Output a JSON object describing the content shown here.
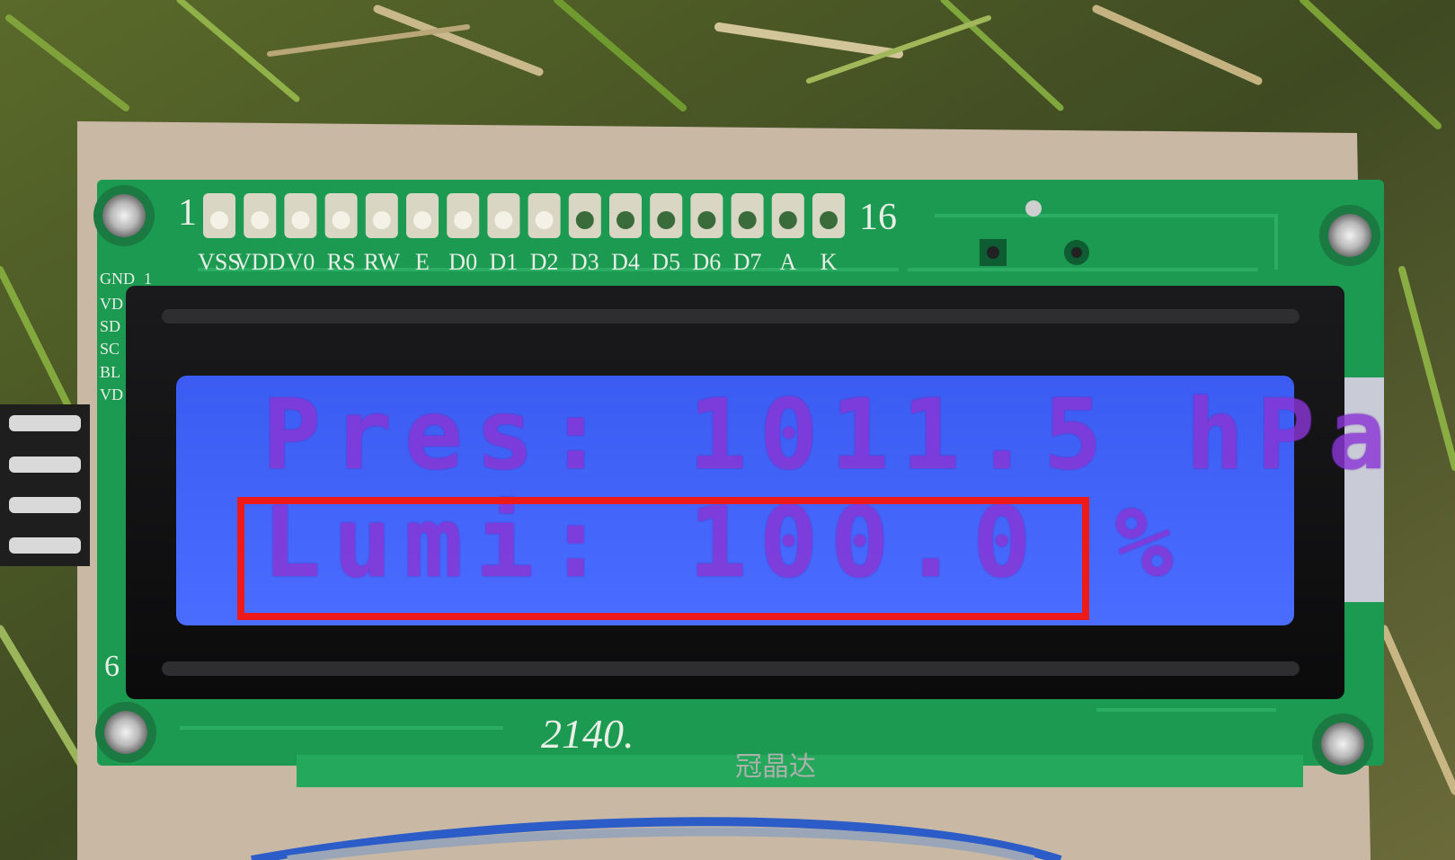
{
  "lcd": {
    "line1": "Pres: 1011.5 hPa",
    "line2": "Lumi: 100.0 %"
  },
  "pcb": {
    "pin_first": "1",
    "pin_last": "16",
    "pin_labels": [
      "VSS",
      "VDD",
      "V0",
      "RS",
      "RW",
      "E",
      "D0",
      "D1",
      "D2",
      "D3",
      "D4",
      "D5",
      "D6",
      "D7",
      "A",
      "K"
    ],
    "side_labels": [
      "GND",
      "1",
      "VD",
      "SD",
      "SC",
      "BL",
      "VD"
    ],
    "side_pin_number": "6",
    "silk_code": "2140.",
    "brand_mark": "冠晶达"
  },
  "colors": {
    "pcb_green": "#1c9a52",
    "lcd_backlight": "#3f62f5",
    "lcd_text": "#8a35d6",
    "highlight": "#ee1a1a"
  }
}
